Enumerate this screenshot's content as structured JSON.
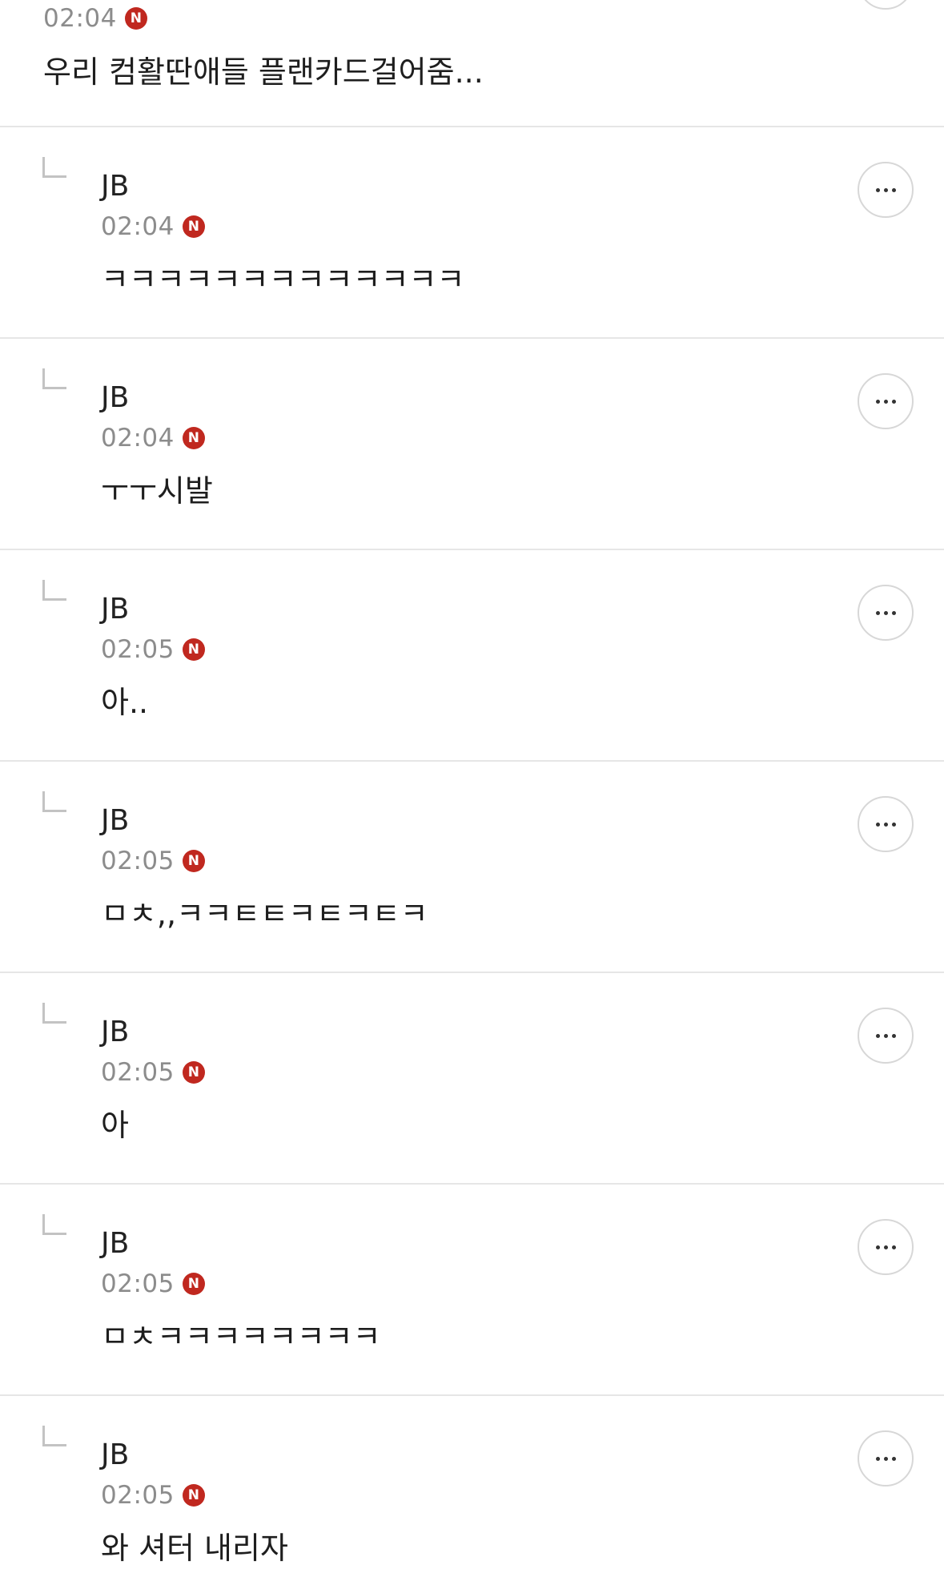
{
  "top_comment": {
    "time": "02:04",
    "badge": "N",
    "text": "우리 컴활딴애들 플랜카드걸어줌..."
  },
  "replies": [
    {
      "author": "JB",
      "time": "02:04",
      "badge": "N",
      "text": "ㅋㅋㅋㅋㅋㅋㅋㅋㅋㅋㅋㅋㅋ"
    },
    {
      "author": "JB",
      "time": "02:04",
      "badge": "N",
      "text": "ㅜㅜ시발"
    },
    {
      "author": "JB",
      "time": "02:05",
      "badge": "N",
      "text": "아.."
    },
    {
      "author": "JB",
      "time": "02:05",
      "badge": "N",
      "text": "ㅁㅊ,,ㅋㅋㅌㅌㅋㅌㅋㅌㅋ"
    },
    {
      "author": "JB",
      "time": "02:05",
      "badge": "N",
      "text": "아"
    },
    {
      "author": "JB",
      "time": "02:05",
      "badge": "N",
      "text": "ㅁㅊㅋㅋㅋㅋㅋㅋㅋㅋ"
    },
    {
      "author": "JB",
      "time": "02:05",
      "badge": "N",
      "text": "와 셔터 내리자"
    }
  ],
  "icons": {
    "more": "more-options-icon",
    "reply": "reply-arrow-icon"
  },
  "colors": {
    "new_badge": "#c0281f",
    "divider": "#e6e6e6",
    "timestamp": "#8c8c8c"
  }
}
